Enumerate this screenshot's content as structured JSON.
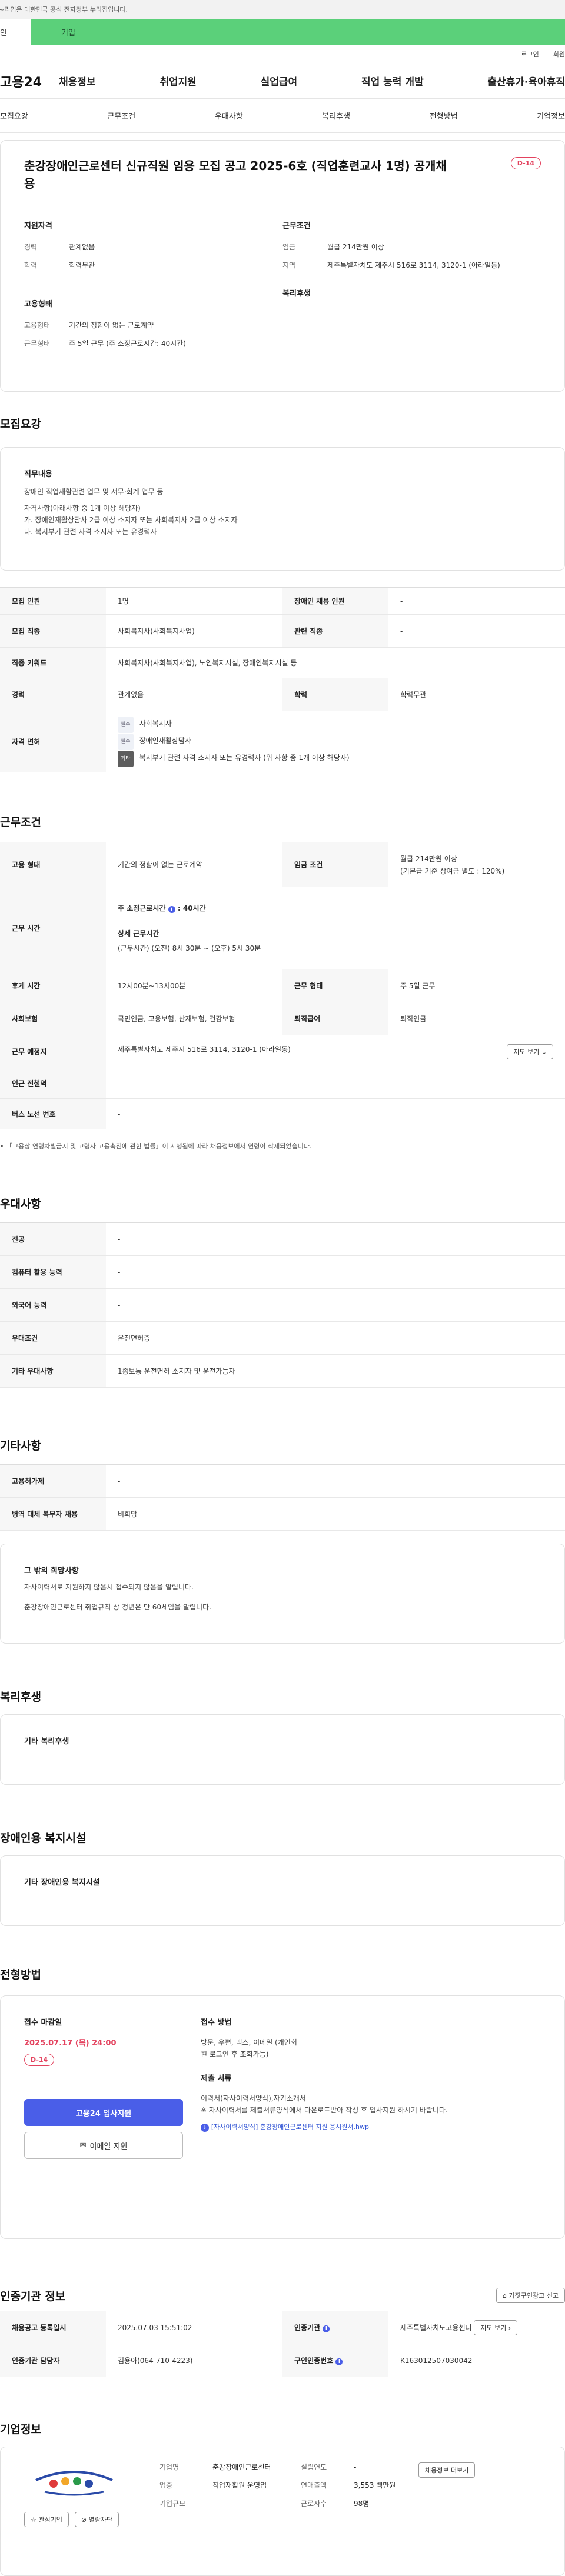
{
  "banner": {
    "text": "~리입은 대한민국 공식 전자정부 누리집입니다."
  },
  "segments": {
    "personal": "인",
    "company": "기업"
  },
  "util": {
    "login": "로그인",
    "join": "회원"
  },
  "gnb": {
    "logo": "고용24",
    "menu": [
      "채용정보",
      "취업지원",
      "실업급여",
      "직업 능력 개발",
      "출산휴가·육아휴직"
    ]
  },
  "tabs": [
    "모집요강",
    "근무조건",
    "우대사항",
    "복리후생",
    "전형방법",
    "기업정보"
  ],
  "header": {
    "title": "춘강장애인근로센터 신규직원 임용 모집 공고 2025-6호 (직업훈련교사 1명) 공개채용",
    "dday": "D-14",
    "qualification": {
      "title": "지원자격",
      "rows": [
        {
          "k": "경력",
          "v": "관계없음"
        },
        {
          "k": "학력",
          "v": "학력무관"
        }
      ]
    },
    "employment": {
      "title": "고용형태",
      "rows": [
        {
          "k": "고용형태",
          "v": "기간의 정함이 없는 근로계약"
        },
        {
          "k": "근무형태",
          "v": "주 5일 근무 (주 소정근로시간: 40시간)"
        }
      ]
    },
    "conditions": {
      "title": "근무조건",
      "rows": [
        {
          "k": "임금",
          "v": "월급 214만원 이상"
        },
        {
          "k": "지역",
          "v": "제주특별자치도 제주시 516로 3114, 3120-1 (아라일동)"
        }
      ]
    },
    "welfare": {
      "title": "복리후생"
    }
  },
  "recruit": {
    "section_title": "모집요강",
    "duty_title": "직무내용",
    "duty_lines": [
      "장애인 직업재활관련 업무 및 서무·회계 업무 등",
      "",
      "자격사항(아래사항 중 1개 이상 해당자)",
      "가. 장애인재활상담사 2급 이상 소지자 또는 사회복지사 2급 이상 소지자",
      "나. 복지부기 관련 자격 소지자 또는 유경력자"
    ],
    "rows": {
      "count_k": "모집 인원",
      "count_v": "1명",
      "disabled_k": "장애인 채용 인원",
      "disabled_v": "-",
      "job_k": "모집 직종",
      "job_v": "사회복지사(사회복지사업)",
      "related_k": "관련 직종",
      "related_v": "-",
      "kw_k": "직종 키워드",
      "kw_v": "사회복지사(사회복지사업), 노인복지시설, 장애인복지시설 등",
      "career_k": "경력",
      "career_v": "관계없음",
      "edu_k": "학력",
      "edu_v": "학력무관",
      "license_k": "자격 면허"
    },
    "licenses": [
      {
        "tag": "필수",
        "name": "사회복지사"
      },
      {
        "tag": "필수",
        "name": "장애인재활상담사"
      },
      {
        "tag": "기타",
        "name": "복지부기 관련 자격 소지자 또는 유경력자 (위 사항 중 1개 이상 해당자)"
      }
    ]
  },
  "work": {
    "section_title": "근무조건",
    "type_k": "고용 형태",
    "type_v": "기간의 정함이 없는 근로계약",
    "wage_k": "임금 조건",
    "wage_v1": "월급 214만원 이상",
    "wage_v2": "(기본급 기준 상여금 별도 : 120%)",
    "hours_k": "근무 시간",
    "hours_title": "주 소정근로시간",
    "hours_value": "40시간",
    "hours_detail_title": "상세 근무시간",
    "hours_detail": "(근무시간) (오전) 8시 30분 ~ (오후) 5시 30분",
    "break_k": "휴게 시간",
    "break_v": "12시00분~13시00분",
    "form_k": "근무 형태",
    "form_v": "주 5일 근무",
    "insurance_k": "사회보험",
    "insurance_v": "국민연금, 고용보험, 산재보험, 건강보험",
    "severance_k": "퇴직급여",
    "severance_v": "퇴직연금",
    "place_k": "근무 예정지",
    "place_v": "제주특별자치도 제주시 516로 3114, 3120-1 (아라일동)",
    "map_btn": "지도 보기",
    "subway_k": "인근 전철역",
    "subway_v": "-",
    "bus_k": "버스 노선 번호",
    "bus_v": "-",
    "footnote": "「고용상 연령차별금지 및 고령자 고용촉진에 관한 법률」이 시행됨에 따라 채용정보에서 연령이 삭제되었습니다."
  },
  "pref": {
    "section_title": "우대사항",
    "rows": [
      {
        "k": "전공",
        "v": "-"
      },
      {
        "k": "컴퓨터 활용 능력",
        "v": "-"
      },
      {
        "k": "외국어 능력",
        "v": "-"
      },
      {
        "k": "우대조건",
        "v": "운전면허증"
      },
      {
        "k": "기타 우대사항",
        "v": "1종보통 운전면허 소지자 및 운전가능자"
      }
    ]
  },
  "etc": {
    "section_title": "기타사항",
    "rows": [
      {
        "k": "고용허가제",
        "v": "-"
      },
      {
        "k": "병역 대체 복무자 채용",
        "v": "비희망"
      }
    ],
    "other_title": "그 밖의 희망사항",
    "other_lines": [
      "자사이력서로  지원하지 않음시 접수되지 않음을 알립니다.",
      "",
      "춘강장애인근로센터 취업규칙 상 정년은 만 60세임을 알립니다."
    ]
  },
  "benefit": {
    "section_title": "복리후생",
    "box_title": "기타 복리후생",
    "box_value": "-"
  },
  "facility": {
    "section_title": "장애인용 복지시설",
    "box_title": "기타 장애인용 복지시설",
    "box_value": "-"
  },
  "screening": {
    "section_title": "전형방법",
    "deadline_title": "접수 마감일",
    "deadline": "2025.07.17 (목) 24:00",
    "dday": "D-14",
    "apply_btn": "고용24 입사지원",
    "email_btn": "이메일 지원",
    "method_title": "접수 방법",
    "method_lines": [
      "방문, 우편, 팩스, 이메일 (개인회원 로그인 후 조회가능)"
    ],
    "docs_title": "제출 서류",
    "docs_lines": [
      "이력서(자사이력서양식),자기소개서",
      "※ 자사이력서를 제출서류양식에서 다운로드받아 작성 후 입사지원 하시기 바랍니다."
    ],
    "docs_link": "[자사이력서양식] 춘강장애인근로센터 지원 응시원서.hwp"
  },
  "auth": {
    "section_title": "인증기관 정보",
    "report_btn": "거짓구인광고 신고",
    "reg_k": "채용공고 등록일시",
    "reg_v": "2025.07.03 15:51:02",
    "org_k": "인증기관",
    "org_v": "제주특별자치도고용센터",
    "org_btn": "지도 보기",
    "manager_k": "인증기관 담당자",
    "manager_v": "김용아(064-710-4223)",
    "id_k": "구인인증번호",
    "id_v": "K163012507030042"
  },
  "company": {
    "section_title": "기업정보",
    "follow_btn": "관심기업",
    "block_btn": "열람차단",
    "name_k": "기업명",
    "name_v": "춘강장애인근로센터",
    "industry_k": "업종",
    "industry_v": "직업재활원 운영업",
    "size_k": "기업규모",
    "size_v": "-",
    "founded_k": "설립연도",
    "founded_v": "-",
    "sales_k": "연매출액",
    "sales_v": "3,553 백만원",
    "emp_k": "근로자수",
    "emp_v": "98명",
    "more_btn": "채용정보 더보기"
  }
}
